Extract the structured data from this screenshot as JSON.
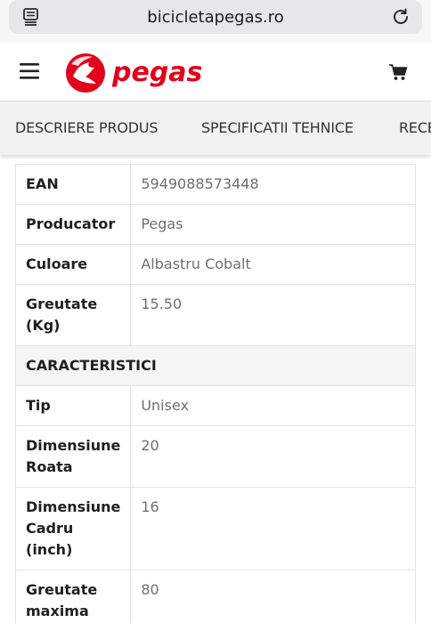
{
  "browser": {
    "url": "bicicletapegas.ro",
    "icons": {
      "reader": "reader-mode-icon",
      "reload": "reload-icon"
    }
  },
  "header": {
    "logo_text": "pegas",
    "brand_color": "#e3001b",
    "icons": {
      "menu": "hamburger-menu-icon",
      "cart": "shopping-cart-icon"
    }
  },
  "tabs": [
    {
      "label": "DESCRIERE PRODUS"
    },
    {
      "label": "SPECIFICATII TEHNICE"
    },
    {
      "label": "RECE"
    }
  ],
  "specs": {
    "rows_top": [
      {
        "key": "EAN",
        "value": "5949088573448"
      },
      {
        "key": "Producator",
        "value": "Pegas"
      },
      {
        "key": "Culoare",
        "value": "Albastru Cobalt"
      },
      {
        "key": "Greutate (Kg)",
        "value": "15.50"
      }
    ],
    "section_title": "CARACTERISTICI",
    "rows_bottom": [
      {
        "key": "Tip",
        "value": "Unisex"
      },
      {
        "key": "Dimensiune Roata",
        "value": "20"
      },
      {
        "key": "Dimensiune Cadru (inch)",
        "value": "16"
      },
      {
        "key": "Greutate maxima",
        "value": "80"
      }
    ]
  }
}
